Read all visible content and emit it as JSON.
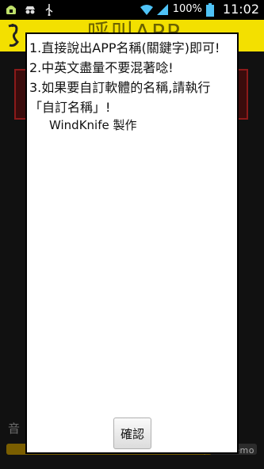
{
  "status_bar": {
    "icons_left": [
      "android-debug-icon",
      "incognito-icon",
      "usb-icon"
    ],
    "battery": "100%",
    "time": "11:02"
  },
  "background_app": {
    "title": "呼叫APP",
    "volume_label": "音",
    "slider_level": 0.82,
    "watermark": "LG QuickMemo"
  },
  "dialog": {
    "lines": [
      "1.直接說出APP名稱(關鍵字)即可!",
      "2.中英文盡量不要混著唸!",
      "3.如果要自訂軟體的名稱,請執行「自訂名稱」!"
    ],
    "credit": "WindKnife 製作",
    "confirm_label": "確認"
  },
  "colors": {
    "accent": "#f3e000",
    "status_bar": "#000000"
  }
}
